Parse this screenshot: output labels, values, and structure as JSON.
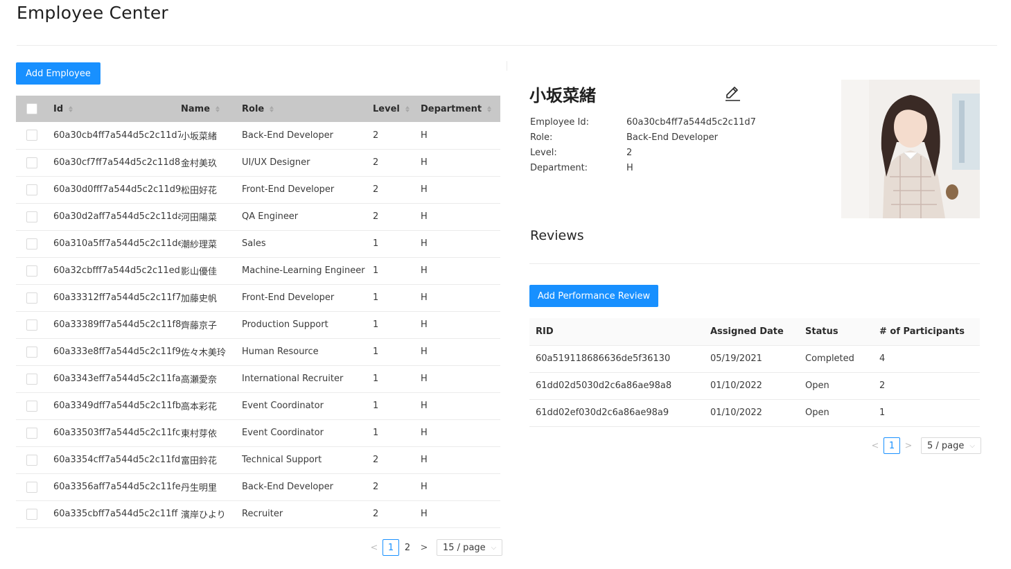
{
  "page": {
    "title": "Employee Center"
  },
  "toolbar": {
    "add_employee_label": "Add Employee"
  },
  "employee_table": {
    "columns": [
      "Id",
      "Name",
      "Role",
      "Level",
      "Department"
    ],
    "rows": [
      {
        "id": "60a30cb4ff7a544d5c2c11d7",
        "name": "小坂菜緒",
        "role": "Back-End Developer",
        "level": "2",
        "department": "H"
      },
      {
        "id": "60a30cf7ff7a544d5c2c11d8",
        "name": "金村美玖",
        "role": "UI/UX Designer",
        "level": "2",
        "department": "H"
      },
      {
        "id": "60a30d0fff7a544d5c2c11d9",
        "name": "松田好花",
        "role": "Front-End Developer",
        "level": "2",
        "department": "H"
      },
      {
        "id": "60a30d2aff7a544d5c2c11da",
        "name": "河田陽菜",
        "role": "QA Engineer",
        "level": "2",
        "department": "H"
      },
      {
        "id": "60a310a5ff7a544d5c2c11de",
        "name": "潮紗理菜",
        "role": "Sales",
        "level": "1",
        "department": "H"
      },
      {
        "id": "60a32cbfff7a544d5c2c11ed",
        "name": "影山優佳",
        "role": "Machine-Learning Engineer",
        "level": "1",
        "department": "H"
      },
      {
        "id": "60a33312ff7a544d5c2c11f7",
        "name": "加藤史帆",
        "role": "Front-End Developer",
        "level": "1",
        "department": "H"
      },
      {
        "id": "60a33389ff7a544d5c2c11f8",
        "name": "齊藤京子",
        "role": "Production Support",
        "level": "1",
        "department": "H"
      },
      {
        "id": "60a333e8ff7a544d5c2c11f9",
        "name": "佐々木美玲",
        "role": "Human Resource",
        "level": "1",
        "department": "H"
      },
      {
        "id": "60a3343eff7a544d5c2c11fa",
        "name": "高瀬愛奈",
        "role": "International Recruiter",
        "level": "1",
        "department": "H"
      },
      {
        "id": "60a3349dff7a544d5c2c11fb",
        "name": "高本彩花",
        "role": "Event Coordinator",
        "level": "1",
        "department": "H"
      },
      {
        "id": "60a33503ff7a544d5c2c11fc",
        "name": "東村芽依",
        "role": "Event Coordinator",
        "level": "1",
        "department": "H"
      },
      {
        "id": "60a3354cff7a544d5c2c11fd",
        "name": "富田鈴花",
        "role": "Technical Support",
        "level": "2",
        "department": "H"
      },
      {
        "id": "60a3356aff7a544d5c2c11fe",
        "name": "丹生明里",
        "role": "Back-End Developer",
        "level": "2",
        "department": "H"
      },
      {
        "id": "60a335cbff7a544d5c2c11ff",
        "name": "濱岸ひより",
        "role": "Recruiter",
        "level": "2",
        "department": "H"
      }
    ],
    "pagination": {
      "prev": "<",
      "pages": [
        "1",
        "2"
      ],
      "current": "1",
      "next": ">",
      "page_size": "15 / page"
    }
  },
  "detail": {
    "name": "小坂菜緒",
    "fields": [
      {
        "label": "Employee Id:",
        "value": "60a30cb4ff7a544d5c2c11d7"
      },
      {
        "label": "Role:",
        "value": "Back-End Developer"
      },
      {
        "label": "Level:",
        "value": "2"
      },
      {
        "label": "Department:",
        "value": "H"
      }
    ]
  },
  "reviews": {
    "title": "Reviews",
    "add_label": "Add Performance Review",
    "columns": [
      "RID",
      "Assigned Date",
      "Status",
      "# of Participants"
    ],
    "rows": [
      {
        "rid": "60a519118686636de5f36130",
        "date": "05/19/2021",
        "status": "Completed",
        "participants": "4"
      },
      {
        "rid": "61dd02d5030d2c6a86ae98a8",
        "date": "01/10/2022",
        "status": "Open",
        "participants": "2"
      },
      {
        "rid": "61dd02ef030d2c6a86ae98a9",
        "date": "01/10/2022",
        "status": "Open",
        "participants": "1"
      }
    ],
    "pagination": {
      "prev": "<",
      "current": "1",
      "next": ">",
      "page_size": "5 / page"
    }
  },
  "colors": {
    "primary": "#1890ff",
    "table_header": "#c8c8c8",
    "divider": "#ebebeb"
  }
}
